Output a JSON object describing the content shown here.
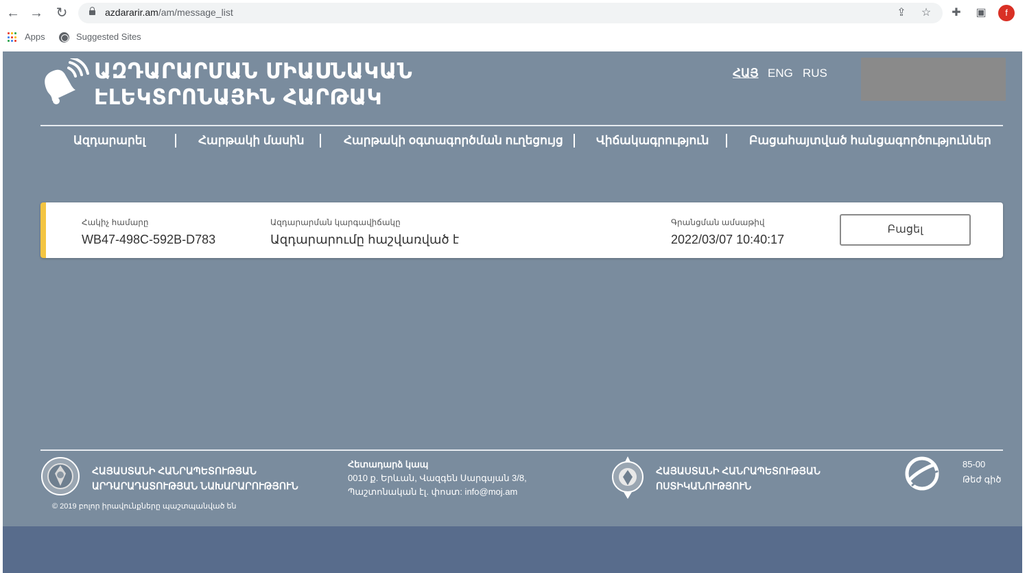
{
  "browser": {
    "url_domain": "azdararir.am",
    "url_path": "/am/message_list",
    "bookmarks": [
      {
        "label": "Apps",
        "icon": "apps-grid-icon"
      },
      {
        "label": "Suggested Sites",
        "icon": "globe-icon"
      }
    ],
    "profile_initial": "f",
    "profile_color": "#d93025"
  },
  "header": {
    "title_line1": "ԱԶԴԱՐԱՐՄԱՆ ՄԻԱՍՆԱԿԱՆ",
    "title_line2": "ԷԼԵԿՏՐՈՆԱՅԻՆ ՀԱՐԹԱԿ",
    "languages": [
      "ՀԱՅ",
      "ENG",
      "RUS"
    ],
    "active_language": "ՀԱՅ"
  },
  "menu": {
    "items": [
      "Ազդարարել",
      "Հարթակի մասին",
      "Հարթակի օգտագործման ուղեցույց",
      "Վիճակագրություն",
      "Բացահայտված հանցագործություններ"
    ]
  },
  "message": {
    "id_label": "Հակիչ համարը",
    "id_value": "WB47-498C-592B-D783",
    "status_label": "Ազդարարման կարգավիճակը",
    "status_value": "Ազդարարումը հաշվառված է",
    "date_label": "Գրանցման ամսաթիվ",
    "date_value": "2022/03/07 10:40:17",
    "open_button": "Բացել",
    "accent_color": "#f4c542"
  },
  "footer": {
    "ministry_line1": "ՀԱՅԱՍՏԱՆԻ ՀԱՆՐԱՊԵՏՈՒԹՅԱՆ",
    "ministry_line2": "ԱՐԴԱՐԱԴԱՏՈՒԹՅԱՆ ՆԱԽԱՐԱՐՈՒԹՅՈՒՆ",
    "copyright": "© 2019 բոլոր իրավունքները պաշտպանված են",
    "contact_title": "Հետադարձ կապ",
    "contact_address": "0010 ք. Երևան, Վազգեն Սարգսյան 3/8,",
    "contact_email": "Պաշտոնական էլ. փոստ: info@moj.am",
    "police_line1": "ՀԱՅԱՍՏԱՆԻ ՀԱՆՐԱՊԵՏՈՒԹՅԱՆ",
    "police_line2": "ՈՍՏԻԿԱՆՈՒԹՅՈՒՆ",
    "hotline_number": "85-00",
    "hotline_label": "Թեժ գիծ"
  },
  "colors": {
    "page_bg": "#7a8c9e",
    "page_bottom": "#586c8c",
    "header_box": "#8a8a8a"
  }
}
